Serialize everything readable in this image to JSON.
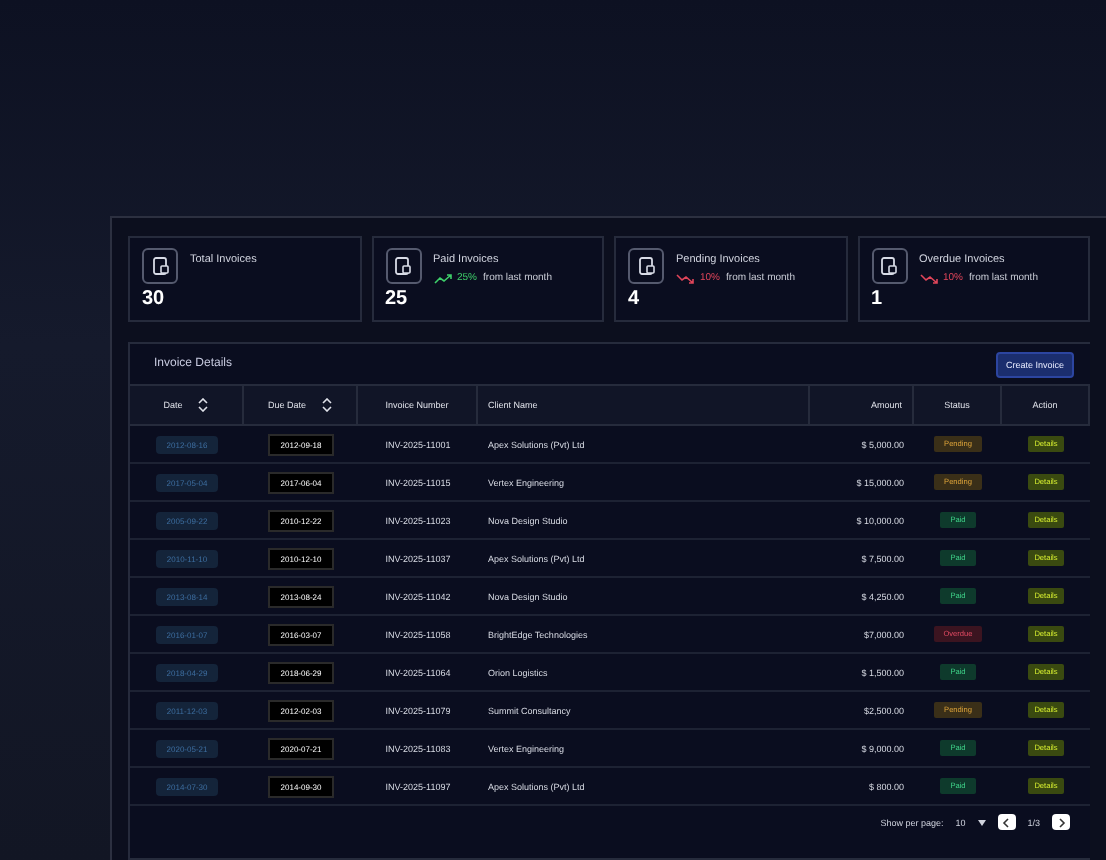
{
  "stats": [
    {
      "label": "Total Invoices",
      "value": "30"
    },
    {
      "label": "Paid Invoices",
      "value": "25",
      "trend": {
        "kind": "up",
        "percent": "25%",
        "note": "from last month"
      }
    },
    {
      "label": "Pending Invoices",
      "value": "4",
      "trend": {
        "kind": "down",
        "percent": "10%",
        "note": "from last month"
      }
    },
    {
      "label": "Overdue Invoices",
      "value": "1",
      "trend": {
        "kind": "down",
        "percent": "10%",
        "note": "from last month"
      }
    }
  ],
  "table": {
    "title": "Invoice Details",
    "create_button": "Create Invoice",
    "columns": [
      {
        "label": "Date",
        "sortable": true
      },
      {
        "label": "Due Date",
        "sortable": true
      },
      {
        "label": "Invoice Number"
      },
      {
        "label": "Client Name"
      },
      {
        "label": "Amount"
      },
      {
        "label": "Status"
      },
      {
        "label": "Action"
      }
    ],
    "rows": [
      {
        "date": "2012-08-16",
        "due": "2012-09-18",
        "number": "INV-2025-11001",
        "client": "Apex Solutions (Pvt) Ltd",
        "amount": "$ 5,000.00",
        "status": "Pending",
        "kind": "pending",
        "action": "Details"
      },
      {
        "date": "2017-05-04",
        "due": "2017-06-04",
        "number": "INV-2025-11015",
        "client": "Vertex Engineering",
        "amount": "$ 15,000.00",
        "status": "Pending",
        "kind": "pending",
        "action": "Details"
      },
      {
        "date": "2005-09-22",
        "due": "2010-12-22",
        "number": "INV-2025-11023",
        "client": "Nova Design Studio",
        "amount": "$ 10,000.00",
        "status": "Paid",
        "kind": "paid",
        "action": "Details"
      },
      {
        "date": "2010-11-10",
        "due": "2010-12-10",
        "number": "INV-2025-11037",
        "client": "Apex Solutions (Pvt) Ltd",
        "amount": "$ 7,500.00",
        "status": "Paid",
        "kind": "paid",
        "action": "Details"
      },
      {
        "date": "2013-08-14",
        "due": "2013-08-24",
        "number": "INV-2025-11042",
        "client": "Nova Design Studio",
        "amount": "$ 4,250.00",
        "status": "Paid",
        "kind": "paid",
        "action": "Details"
      },
      {
        "date": "2016-01-07",
        "due": "2016-03-07",
        "number": "INV-2025-11058",
        "client": "BrightEdge Technologies",
        "amount": "$7,000.00",
        "status": "Overdue",
        "kind": "overdue",
        "action": "Details"
      },
      {
        "date": "2018-04-29",
        "due": "2018-06-29",
        "number": "INV-2025-11064",
        "client": "Orion Logistics",
        "amount": "$ 1,500.00",
        "status": "Paid",
        "kind": "paid",
        "action": "Details"
      },
      {
        "date": "2011-12-03",
        "due": "2012-02-03",
        "number": "INV-2025-11079",
        "client": "Summit Consultancy",
        "amount": "$2,500.00",
        "status": "Pending",
        "kind": "pending",
        "action": "Details"
      },
      {
        "date": "2020-05-21",
        "due": "2020-07-21",
        "number": "INV-2025-11083",
        "client": "Vertex Engineering",
        "amount": "$ 9,000.00",
        "status": "Paid",
        "kind": "paid",
        "action": "Details"
      },
      {
        "date": "2014-07-30",
        "due": "2014-09-30",
        "number": "INV-2025-11097",
        "client": "Apex Solutions (Pvt) Ltd",
        "amount": "$ 800.00",
        "status": "Paid",
        "kind": "paid",
        "action": "Details"
      }
    ]
  },
  "pagination": {
    "per_page_label": "Show per page:",
    "per_page": "10",
    "page": "1/3"
  }
}
